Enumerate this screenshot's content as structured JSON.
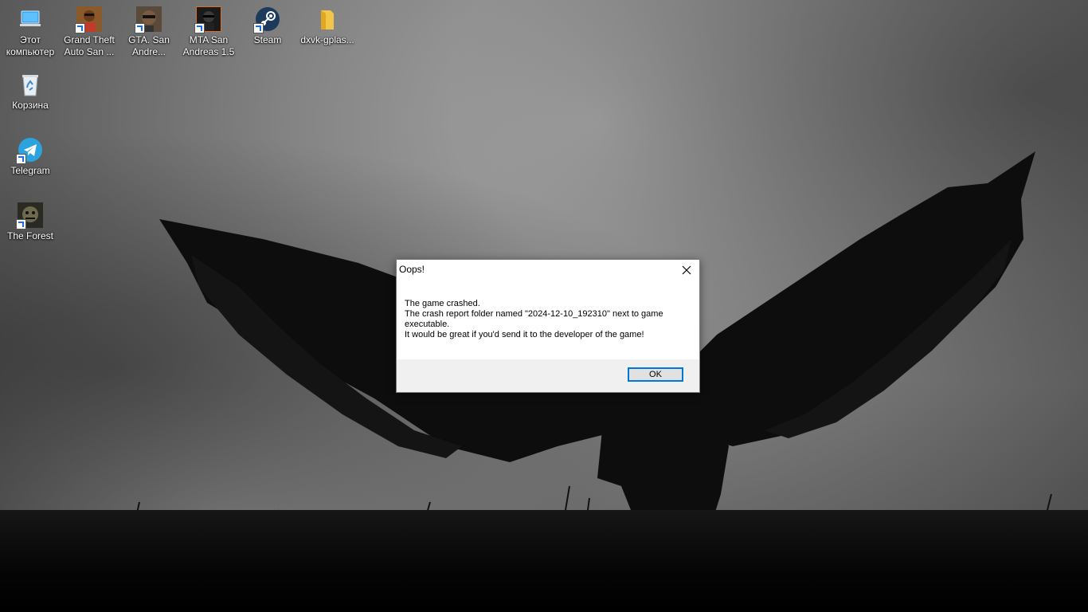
{
  "desktop": {
    "icons": [
      {
        "label": "Этот компьютер",
        "icon": "computer-icon"
      },
      {
        "label": "Grand Theft Auto San ...",
        "icon": "gta-sa-icon"
      },
      {
        "label": "GTA. San Andre...",
        "icon": "gta-sa-alt-icon"
      },
      {
        "label": "MTA San Andreas 1.5",
        "icon": "mta-icon"
      },
      {
        "label": "Steam",
        "icon": "steam-icon"
      },
      {
        "label": "dxvk-gplas...",
        "icon": "folder-icon"
      },
      {
        "label": "Корзина",
        "icon": "recycle-bin-icon"
      },
      {
        "label": "Telegram",
        "icon": "telegram-icon"
      },
      {
        "label": "The Forest",
        "icon": "the-forest-icon"
      }
    ]
  },
  "dialog": {
    "title": "Oops!",
    "lines": [
      "The game crashed.",
      "The crash report folder named \"2024-12-10_192310\" next to game",
      "executable.",
      "It would be great if you'd send it to the developer of the game!"
    ],
    "ok_label": "OK"
  },
  "colors": {
    "dialog_accent": "#0078d7",
    "dialog_footer": "#f0f0f0"
  }
}
